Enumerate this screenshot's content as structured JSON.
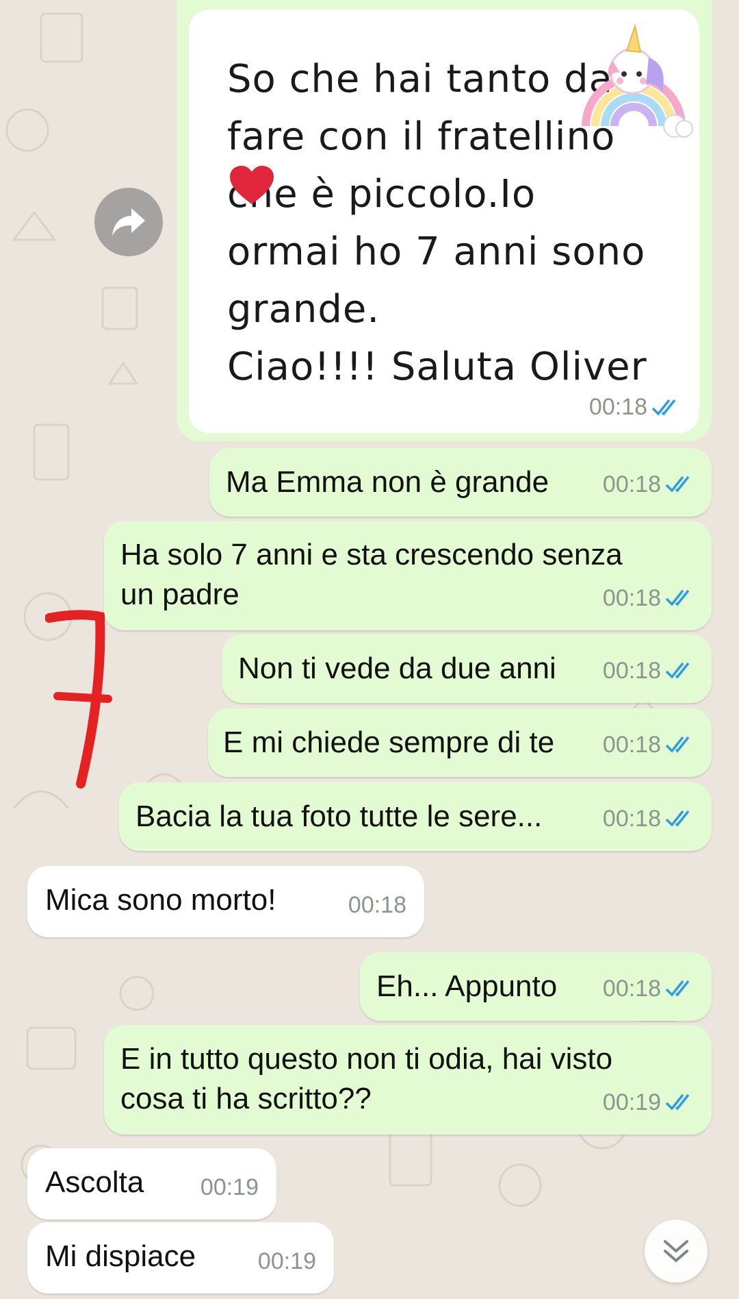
{
  "image_message": {
    "handwritten_text": "So che hai tanto da\nfare con il fratellino\n    che è piccolo.Io\normai ho 7 anni sono\ngrande.\nCiao!!!! Saluta Oliver",
    "time": "00:18",
    "status_icon": "double-check-read-icon"
  },
  "messages": [
    {
      "id": "m1",
      "dir": "out",
      "text": "Ma Emma non è grande",
      "time": "00:18"
    },
    {
      "id": "m2",
      "dir": "out",
      "text": "Ha solo 7 anni e sta crescendo senza\nun padre",
      "time": "00:18"
    },
    {
      "id": "m3",
      "dir": "out",
      "text": "Non ti vede da due anni",
      "time": "00:18"
    },
    {
      "id": "m4",
      "dir": "out",
      "text": "E mi chiede sempre di te",
      "time": "00:18"
    },
    {
      "id": "m5",
      "dir": "out",
      "text": "Bacia la tua foto tutte le sere...",
      "time": "00:18"
    },
    {
      "id": "m6",
      "dir": "in",
      "text": "Mica sono morto!",
      "time": "00:18"
    },
    {
      "id": "m7",
      "dir": "out",
      "text": "Eh... Appunto",
      "time": "00:18"
    },
    {
      "id": "m8",
      "dir": "out",
      "text": "E in tutto questo non ti odia, hai visto\ncosa ti ha scritto??",
      "time": "00:19"
    },
    {
      "id": "m9",
      "dir": "in",
      "text": "Ascolta",
      "time": "00:19"
    },
    {
      "id": "m10",
      "dir": "in",
      "text": "Mi dispiace",
      "time": "00:19"
    }
  ],
  "annotation": {
    "text": "7",
    "color": "#e52222"
  },
  "colors": {
    "outgoing_bubble": "#e2fbd2",
    "incoming_bubble": "#ffffff",
    "read_ticks": "#2f9ee0",
    "background": "#ece5dd"
  },
  "icons": {
    "forward": "forward-arrow-icon",
    "scroll_down": "double-chevron-down-icon",
    "sticker": "unicorn-rainbow-sticker"
  }
}
